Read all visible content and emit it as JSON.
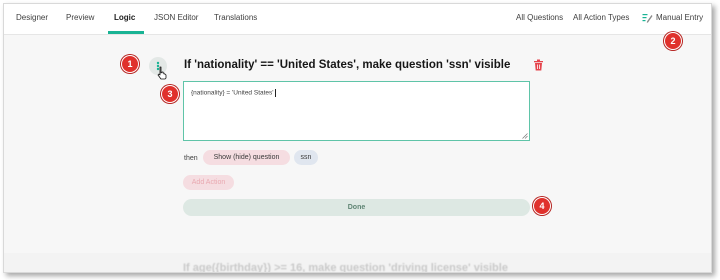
{
  "tabs": [
    "Designer",
    "Preview",
    "Logic",
    "JSON Editor",
    "Translations"
  ],
  "right_links": {
    "all_questions": "All Questions",
    "all_action_types": "All Action Types",
    "manual_entry": "Manual Entry"
  },
  "rule": {
    "title": "If 'nationality' == 'United States', make question 'ssn' visible",
    "expression": "{nationality} = 'United States'",
    "then_label": "then",
    "action_label": "Show (hide) question",
    "question_label": "ssn",
    "add_action_label": "Add Action",
    "done_label": "Done"
  },
  "next_rule_title": "If age({birthday}) >= 16, make question 'driving license' visible",
  "callouts": [
    "1",
    "2",
    "3",
    "4"
  ],
  "colors": {
    "accent": "#19b394",
    "callout": "#e0312c",
    "delete": "#e5444c"
  },
  "icons": [
    "drag-handle-icon",
    "pointer-cursor-icon",
    "manual-entry-icon",
    "trash-icon"
  ]
}
